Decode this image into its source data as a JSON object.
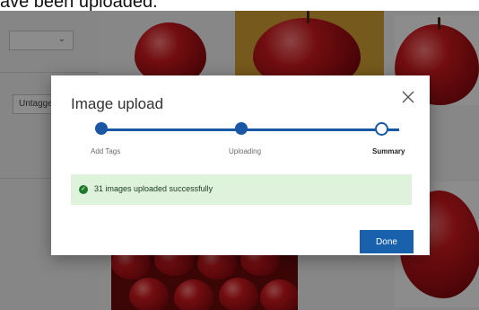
{
  "caption": "ave been uploaded.",
  "background": {
    "filter_label": "Untagge"
  },
  "dialog": {
    "title": "Image upload",
    "steps": [
      {
        "label": "Add Tags"
      },
      {
        "label": "Uploading"
      },
      {
        "label": "Summary"
      }
    ],
    "success_message": "31 images uploaded successfully",
    "done_label": "Done"
  },
  "colors": {
    "accent": "#1a58a6",
    "success_bg": "#dff3dc",
    "success_icon": "#1f7a2c",
    "button": "#1960ad"
  }
}
